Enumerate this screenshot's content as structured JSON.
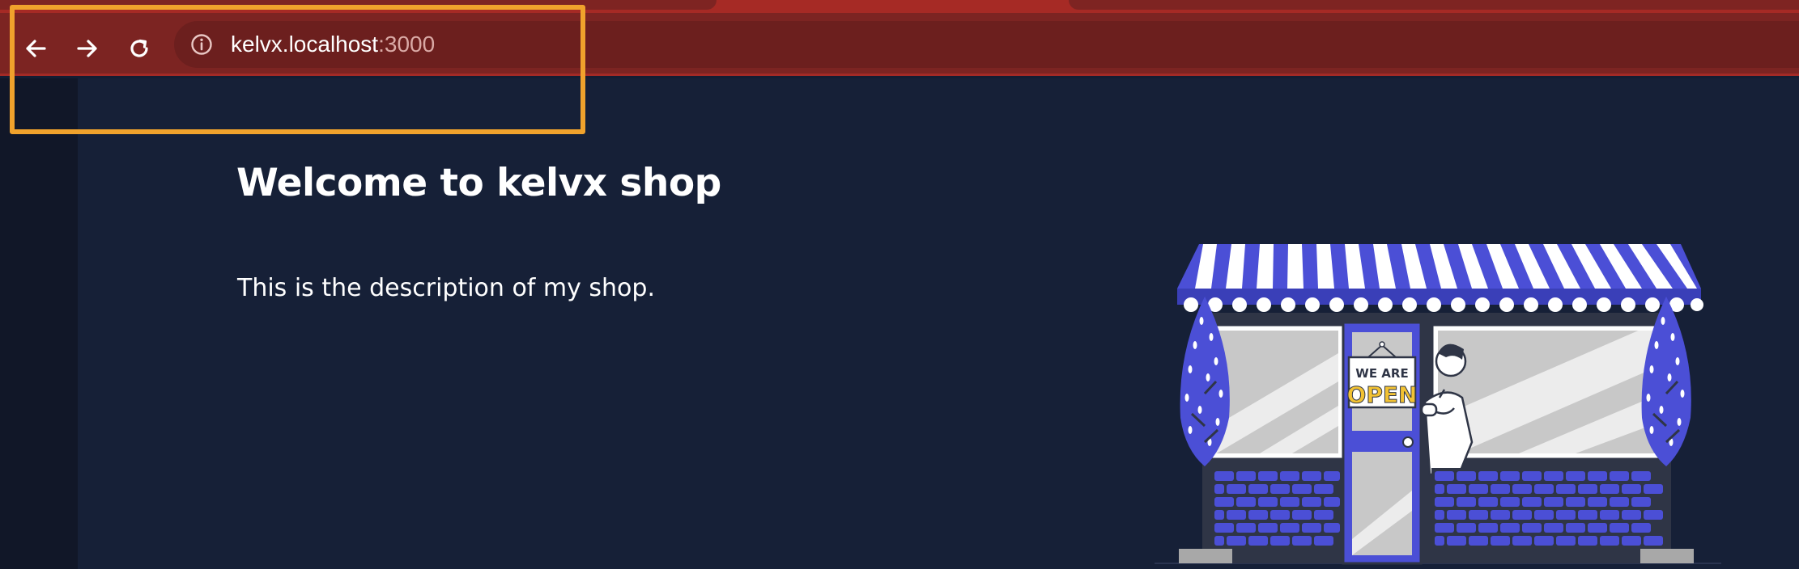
{
  "browser": {
    "url_host": "kelvx.localhost",
    "url_port": ":3000",
    "icons": {
      "back": "arrow-left-icon",
      "forward": "arrow-right-icon",
      "reload": "reload-icon",
      "site_info": "info-icon"
    }
  },
  "page": {
    "title": "Welcome to kelvx shop",
    "description": "This is the description of my shop."
  },
  "illustration": {
    "sign_line1": "WE ARE",
    "sign_line2": "OPEN"
  },
  "colors": {
    "toolbar": "#7c2422",
    "tab_strip": "#a62a25",
    "page_background": "#162037",
    "accent_blue": "#4b4fd6",
    "highlight": "#f0a22c",
    "sign_yellow": "#f2c233"
  }
}
